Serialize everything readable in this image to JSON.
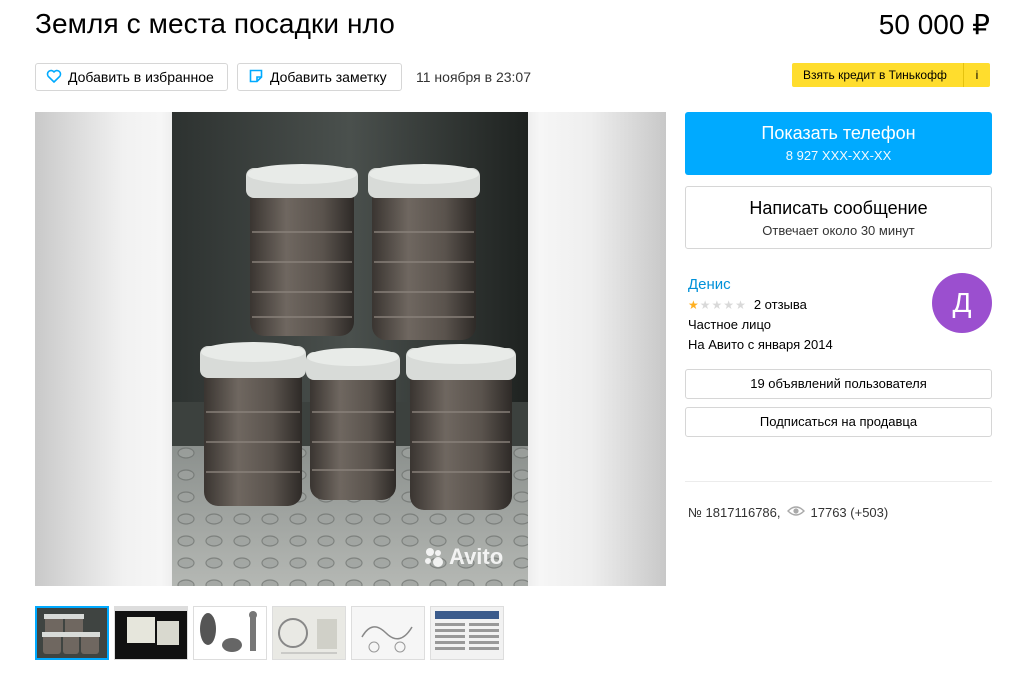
{
  "listing": {
    "title": "Земля с места посадки нло",
    "price": "50 000 ₽",
    "date": "11 ноября в 23:07",
    "number": "№ 1817116786,",
    "views": "17763 (+503)"
  },
  "actions": {
    "favorite_label": "Добавить в избранное",
    "note_label": "Добавить заметку",
    "credit_label": "Взять кредит в Тинькофф",
    "credit_info": "i"
  },
  "contact": {
    "show_phone_label": "Показать телефон",
    "phone_masked": "8 927 XXX-XX-XX",
    "message_label": "Написать сообщение",
    "response_time": "Отвечает около 30 минут"
  },
  "seller": {
    "name": "Денис",
    "rating_stars": 1,
    "reviews": "2 отзыва",
    "type": "Частное лицо",
    "since": "На Авито с января 2014",
    "avatar_letter": "Д",
    "listings_label": "19 объявлений пользователя",
    "subscribe_label": "Подписаться на продавца"
  },
  "gallery": {
    "watermark": "Avito",
    "thumbnails": 6,
    "active_thumbnail": 1
  },
  "colors": {
    "accent": "#00aaff",
    "credit": "#ffdd2d",
    "avatar": "#9b4fcf",
    "link": "#0091d9",
    "star": "#ffb021"
  }
}
